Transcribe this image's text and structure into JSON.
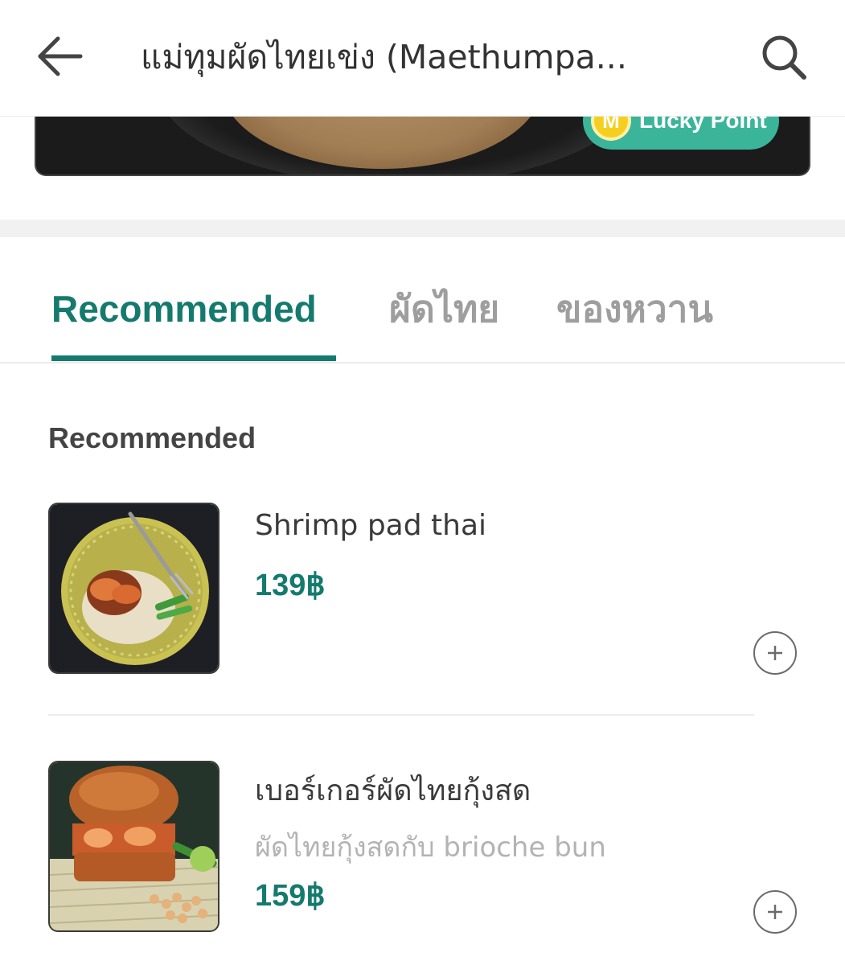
{
  "header": {
    "title": "แม่ทุมผัดไทยเข่ง (Maethumpa...",
    "back_icon": "arrow-left-icon",
    "search_icon": "search-icon"
  },
  "banner": {
    "badge_label": "Lucky Point",
    "badge_coin_letter": "M",
    "badge_color": "#3bb59a"
  },
  "tabs": [
    {
      "label": "Recommended",
      "active": true
    },
    {
      "label": "ผัดไทย",
      "active": false
    },
    {
      "label": "ของหวาน",
      "active": false
    }
  ],
  "section": {
    "title": "Recommended"
  },
  "items": [
    {
      "name": "Shrimp pad thai",
      "description": "",
      "price": "139฿",
      "add_icon": "plus-circle-icon"
    },
    {
      "name": "เบอร์เกอร์ผัดไทยกุ้งสด",
      "description": "ผัดไทยกุ้งสดกับ brioche bun",
      "price": "159฿",
      "add_icon": "plus-circle-icon"
    }
  ],
  "colors": {
    "accent": "#157a6e",
    "inactive_tab": "#9e9e9e"
  }
}
